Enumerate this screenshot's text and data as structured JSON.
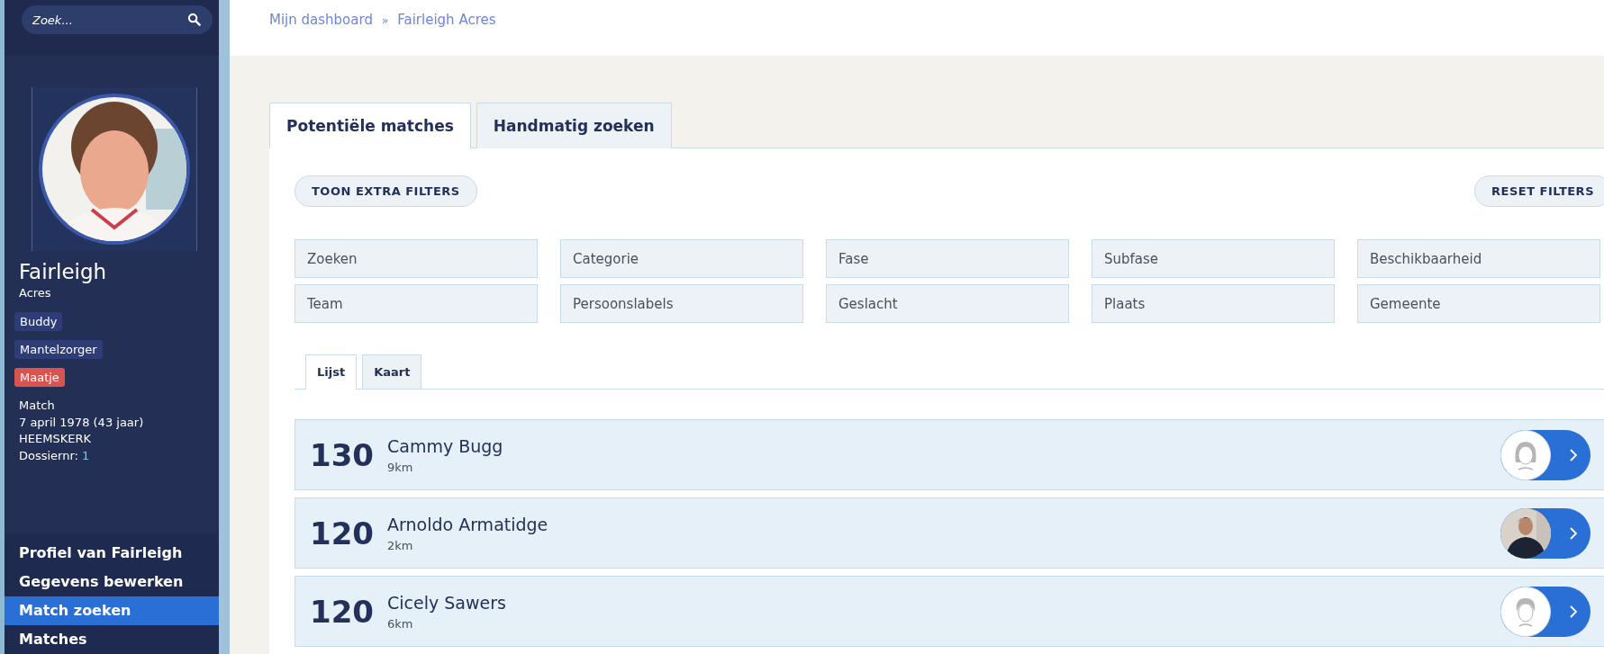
{
  "sidebar": {
    "search": {
      "placeholder": "Zoek..."
    },
    "profile": {
      "first_name": "Fairleigh",
      "last_name": "Acres",
      "tags": [
        {
          "label": "Buddy",
          "color": "#2e3d78"
        },
        {
          "label": "Mantelzorger",
          "color": "#2e3d78"
        },
        {
          "label": "Maatje",
          "color": "#d9534f"
        }
      ],
      "details": [
        "Match",
        "7 april 1978 (43 jaar)",
        "HEEMSKERK"
      ],
      "dossier": {
        "label": "Dossiernr:",
        "value": "1"
      }
    },
    "menu": [
      {
        "label": "Profiel van Fairleigh",
        "selected": false
      },
      {
        "label": "Gegevens bewerken",
        "selected": false
      },
      {
        "label": "Match zoeken",
        "selected": true
      },
      {
        "label": "Matches",
        "selected": false
      }
    ]
  },
  "breadcrumb": [
    "Mijn dashboard",
    "Fairleigh Acres"
  ],
  "breadcrumb_separator": "»",
  "tabs": [
    {
      "label": "Potentiële matches",
      "selected": true
    },
    {
      "label": "Handmatig zoeken",
      "selected": false
    }
  ],
  "buttons": {
    "extra_filters": "TOON EXTRA FILTERS",
    "reset": "RESET FILTERS"
  },
  "filters": [
    {
      "placeholder": "Zoeken"
    },
    {
      "placeholder": "Categorie"
    },
    {
      "placeholder": "Fase"
    },
    {
      "placeholder": "Subfase"
    },
    {
      "placeholder": "Beschikbaarheid"
    },
    {
      "placeholder": "Team"
    },
    {
      "placeholder": "Persoonslabels"
    },
    {
      "placeholder": "Geslacht"
    },
    {
      "placeholder": "Plaats"
    },
    {
      "placeholder": "Gemeente"
    }
  ],
  "view_tabs": [
    {
      "label": "Lijst",
      "selected": true
    },
    {
      "label": "Kaart",
      "selected": false
    }
  ],
  "matches": [
    {
      "score": "130",
      "name": "Cammy Bugg",
      "distance": "9km",
      "kind": "female"
    },
    {
      "score": "120",
      "name": "Arnoldo Armatidge",
      "distance": "2km"
    },
    {
      "score": "120",
      "name": "Cicely Sawers",
      "distance": "6km",
      "kind": "male"
    }
  ]
}
